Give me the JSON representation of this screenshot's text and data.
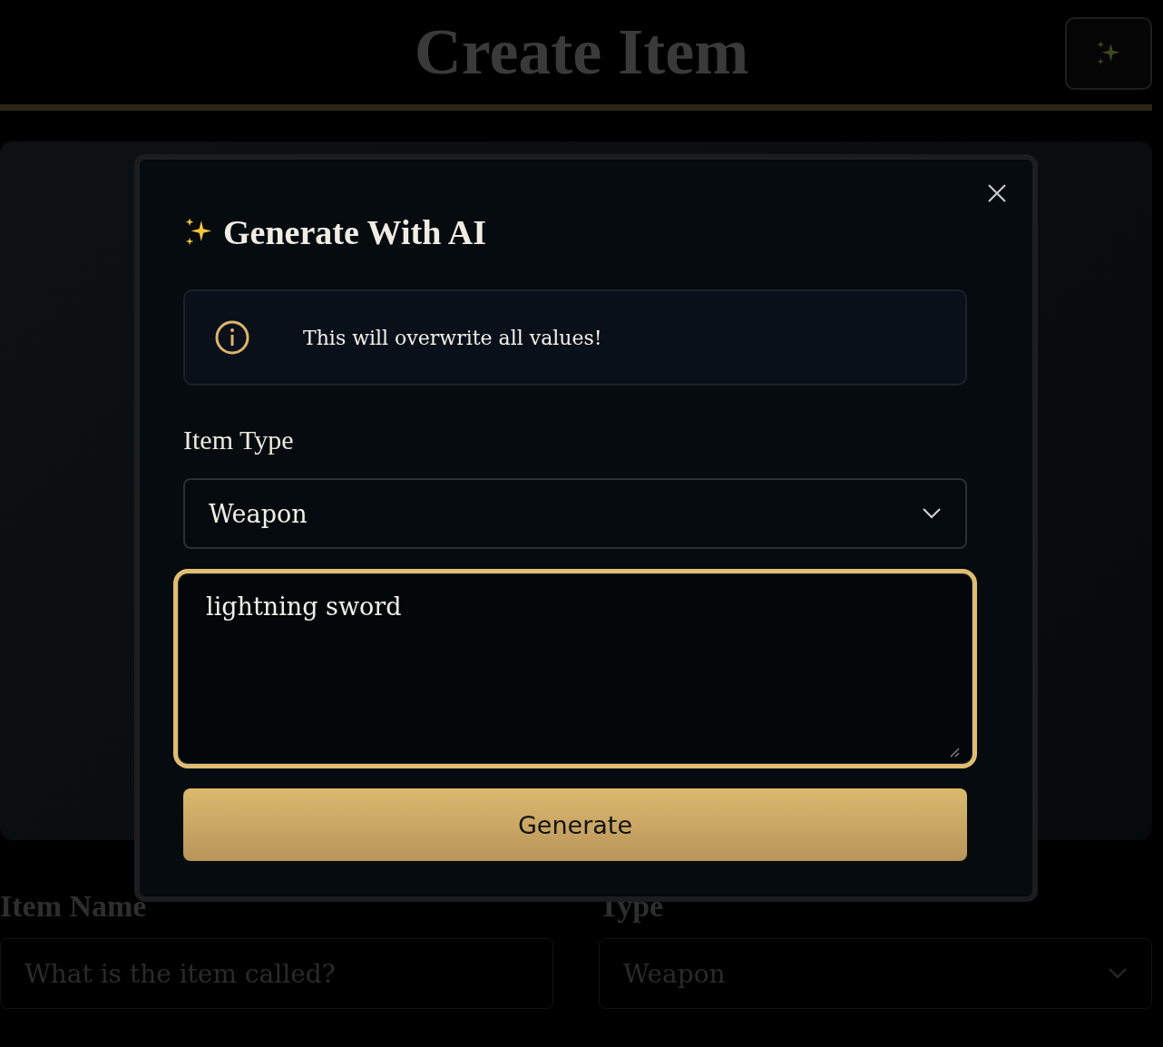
{
  "page": {
    "title": "Create Item",
    "fields": [
      {
        "label": "Item Name",
        "kind": "text",
        "placeholder": "What is the item called?"
      },
      {
        "label": "Type",
        "kind": "select",
        "value": "Weapon"
      }
    ]
  },
  "dialog": {
    "title": "Generate With AI",
    "notice": "This will overwrite all values!",
    "item_type": {
      "label": "Item Type",
      "value": "Weapon"
    },
    "prompt": {
      "value": "lightning sword",
      "focused": true
    },
    "button": "Generate"
  }
}
